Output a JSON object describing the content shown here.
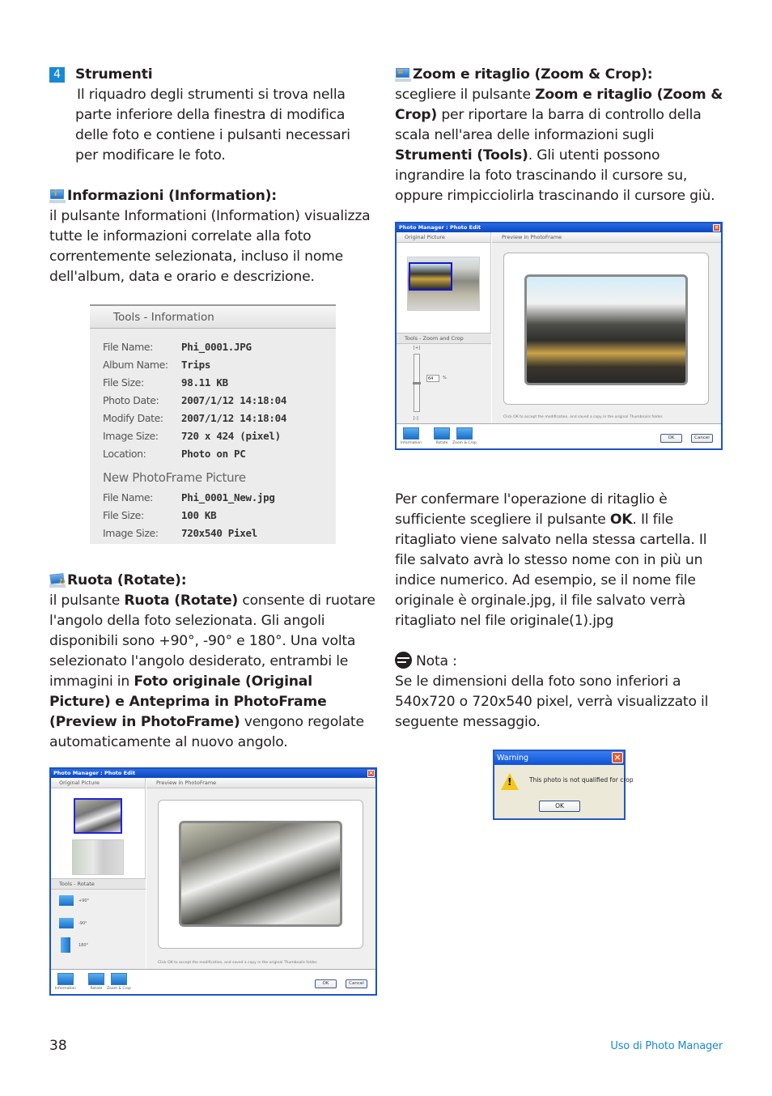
{
  "left_column": {
    "step": {
      "number": "4",
      "title": "Strumenti",
      "body": "Il riquadro degli strumenti si trova nella parte inferiore della finestra di modifica delle foto e contiene i pulsanti necessari per modificare le foto."
    },
    "information": {
      "icon": "information-icon",
      "heading": "Informazioni (Information):",
      "body": "il pulsante Informationi (Information) visualizza tutte le informazioni correlate alla foto correntemente selezionata, incluso il nome dell'album, data e orario e descrizione."
    },
    "info_panel": {
      "title": "Tools - Information",
      "rows": [
        {
          "label": "File Name:",
          "value": "Phi_0001.JPG"
        },
        {
          "label": "Album Name:",
          "value": "Trips"
        },
        {
          "label": "File Size:",
          "value": "98.11 KB"
        },
        {
          "label": "Photo Date:",
          "value": "2007/1/12 14:18:04"
        },
        {
          "label": "Modify Date:",
          "value": "2007/1/12 14:18:04"
        },
        {
          "label": "Image Size:",
          "value": "720 x 424 (pixel)"
        },
        {
          "label": "Location:",
          "value": "Photo on PC"
        }
      ],
      "new_section_title": "New PhotoFrame Picture",
      "new_rows": [
        {
          "label": "File Name:",
          "value": "Phi_0001_New.jpg"
        },
        {
          "label": "File Size:",
          "value": "100 KB"
        },
        {
          "label": "Image Size:",
          "value": "720x540 Pixel"
        }
      ]
    },
    "rotate": {
      "icon": "rotate-icon",
      "heading": "Ruota (Rotate):",
      "body_parts": {
        "p1": "il pulsante ",
        "b1": "Ruota (Rotate)",
        "p2": " consente di ruotare l'angolo della foto selezionata. Gli angoli disponibili sono +90°, -90° e 180°. Una volta selezionato l'angolo desiderato, entrambi le immagini in ",
        "b2": "Foto originale (Original Picture) e Anteprima in PhotoFrame (Preview in PhotoFrame)",
        "p3": " vengono regolate automaticamente al nuovo angolo."
      }
    },
    "rotate_window": {
      "title": "Photo Manager : Photo Edit",
      "original_label": "Original Picture",
      "preview_label": "Preview in PhotoFrame",
      "tools_label": "Tools - Rotate",
      "rotate_options": [
        "+90°",
        "-90°",
        "180°"
      ],
      "hint": "Click OK to accept the modification, and saved a copy in the original Thumbnails folder.",
      "toolbar": [
        "Information",
        "Rotate",
        "Zoom & Crop"
      ],
      "ok": "OK",
      "cancel": "Cancel"
    }
  },
  "right_column": {
    "zoom_crop": {
      "icon": "zoom-crop-icon",
      "heading": "Zoom e ritaglio (Zoom & Crop):",
      "body_parts": {
        "p1": "scegliere il pulsante ",
        "b1": "Zoom e ritaglio (Zoom & Crop)",
        "p2": " per riportare la barra di controllo della scala nell'area delle informazioni sugli ",
        "b2": "Strumenti (Tools)",
        "p3": ". Gli utenti possono ingrandire la foto trascinando il cursore su, oppure rimpicciolirla trascinando il cursore giù."
      }
    },
    "crop_window": {
      "title": "Photo Manager : Photo Edit",
      "original_label": "Original Picture",
      "preview_label": "Preview in PhotoFrame",
      "tools_label": "Tools - Zoom and Crop",
      "zoom_plus": "[+]",
      "zoom_minus": "[-]",
      "zoom_value": "64",
      "zoom_unit": "%",
      "hint": "Click OK to accept the modification, and saved a copy in the original Thumbnails folder.",
      "toolbar": [
        "Information",
        "Rotate",
        "Zoom & Crop"
      ],
      "ok": "OK",
      "cancel": "Cancel"
    },
    "confirm": {
      "p1": "Per confermare l'operazione di ritaglio è sufficiente scegliere il pulsante ",
      "b1": "OK",
      "p2": ". Il file ritagliato viene salvato nella stessa cartella. Il file salvato avrà lo stesso nome con in più un indice numerico. Ad esempio, se il nome file originale è orginale.jpg, il file salvato verrà ritagliato nel file originale(1).jpg"
    },
    "note": {
      "label": "Nota :",
      "body": "Se le dimensioni della foto sono inferiori a 540x720 o 720x540 pixel, verrà visualizzato il seguente messaggio."
    },
    "warning_dialog": {
      "title": "Warning",
      "message": "This photo is not qualified for crop",
      "ok": "OK"
    }
  },
  "footer": {
    "page_number": "38",
    "section_title": "Uso di Photo Manager"
  },
  "colors": {
    "accent": "#1a88d3",
    "text": "#231f20",
    "window_border": "#1c55c4"
  }
}
